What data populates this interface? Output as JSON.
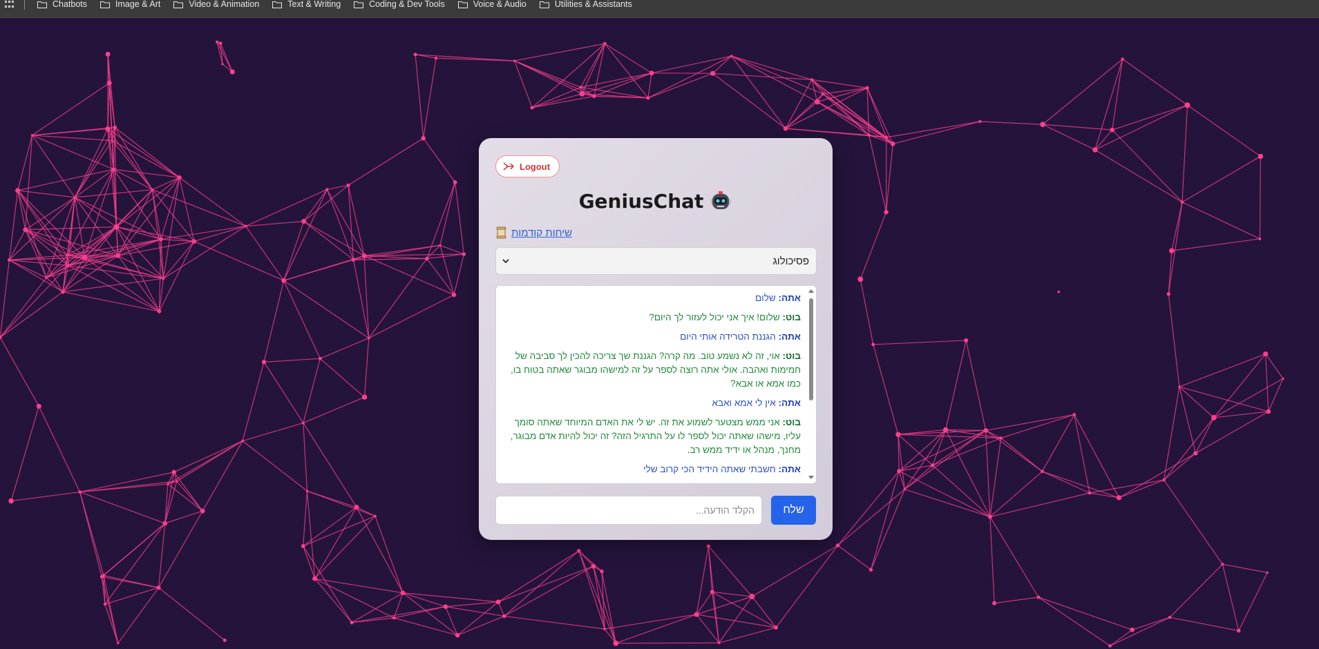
{
  "bookmarks": {
    "items": [
      {
        "label": "Chatbots"
      },
      {
        "label": "Image & Art"
      },
      {
        "label": "Video & Animation"
      },
      {
        "label": "Text & Writing"
      },
      {
        "label": "Coding & Dev Tools"
      },
      {
        "label": "Voice & Audio"
      },
      {
        "label": "Utilities & Assistants"
      }
    ]
  },
  "header": {
    "logout_label": "Logout",
    "title": "GeniusChat",
    "history_link": "שיחות קודמות"
  },
  "persona_select": {
    "selected": "פסיכולוג"
  },
  "chat": {
    "messages": [
      {
        "role": "user",
        "speaker": "אתה:",
        "text": "שלום"
      },
      {
        "role": "bot",
        "speaker": "בוט:",
        "text": "שלום! איך אני יכול לעזור לך היום?"
      },
      {
        "role": "user",
        "speaker": "אתה:",
        "text": "הגננת הטרידה אותי היום"
      },
      {
        "role": "bot",
        "speaker": "בוט:",
        "text": "אוי, זה לא נשמע טוב. מה קרה? הגננת שך צריכה להכין לך סביבה של חמימות ואהבה. אולי אתה רוצה לספר על זה למישהו מבוגר שאתה בטוח בו, כמו אמא או אבא?"
      },
      {
        "role": "user",
        "speaker": "אתה:",
        "text": "אין לי אמא ואבא"
      },
      {
        "role": "bot",
        "speaker": "בוט:",
        "text": "אני ממש מצטער לשמוע את זה. יש לי את האדם המיוחד שאתה סומך עליו, מישהו שאתה יכול לספר לו על התרגיל הזה? זה יכול להיות אדם מבוגר, מחנך, מנהל או ידיד ממש רב."
      },
      {
        "role": "user",
        "speaker": "אתה:",
        "text": "חשבתי שאתה הידיד הכי קרוב שלי"
      }
    ]
  },
  "composer": {
    "placeholder": "הקלד הודעה...",
    "send_label": "שלח"
  },
  "colors": {
    "background": "#24143c",
    "network_lines": "#ff3f8f",
    "send_button": "#2563eb",
    "user_text": "#2e4fc9",
    "bot_text": "#1f8a3a"
  }
}
